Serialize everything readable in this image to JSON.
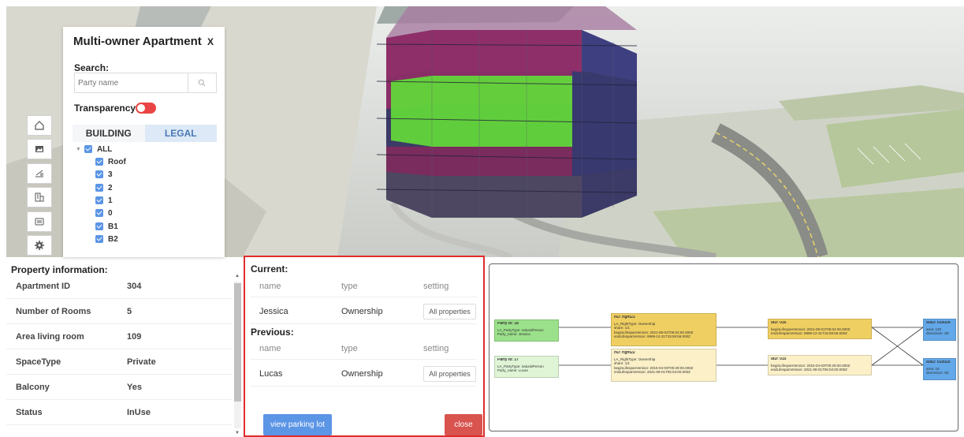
{
  "multi_owner": {
    "title": "Multi-owner Apartment",
    "close_label": "X",
    "search_label": "Search:",
    "search_placeholder": "Party name",
    "transparency_label": "Transparency:",
    "tabs": [
      "BUILDING",
      "LEGAL"
    ],
    "tree_root": "ALL",
    "tree_items": [
      "Roof",
      "3",
      "2",
      "1",
      "0",
      "B1",
      "B2"
    ]
  },
  "toolbar_icons": [
    "home-icon",
    "image-icon",
    "measure-icon",
    "building-icon",
    "layers-icon",
    "gear-icon"
  ],
  "property": {
    "title": "Property information:",
    "rows": [
      {
        "key": "Apartment ID",
        "value": "304"
      },
      {
        "key": "Number of Rooms",
        "value": "5"
      },
      {
        "key": "Area living room",
        "value": "109"
      },
      {
        "key": "SpaceType",
        "value": "Private"
      },
      {
        "key": "Balcony",
        "value": "Yes"
      },
      {
        "key": "Status",
        "value": "InUse"
      }
    ]
  },
  "ownership": {
    "current_label": "Current:",
    "previous_label": "Previous:",
    "columns": [
      "name",
      "type",
      "setting"
    ],
    "current": [
      {
        "name": "Jessica",
        "type": "Ownership",
        "setting": "All properties"
      }
    ],
    "previous": [
      {
        "name": "Lucas",
        "type": "Ownership",
        "setting": "All properties"
      }
    ],
    "view_parking_label": "view parking lot",
    "close_label": "close"
  },
  "diagram": {
    "parties": [
      {
        "title": "Party id: 18",
        "lines": [
          "LA_PartyType: naturalPerson",
          "Party_name: Jessica"
        ]
      },
      {
        "title": "Party id: 17",
        "lines": [
          "LA_PartyType: naturalPerson",
          "Party_name: Lucas"
        ]
      }
    ],
    "rights": [
      {
        "title": "rID: right23",
        "lines": [
          "LA_RightType: Ownership",
          "share: 1/1",
          "beginLifespanVersion: 2021-08-01T06:04:00.000Z",
          "endLifespanVersion: 9999-12-31T15:59:59.000Z"
        ]
      },
      {
        "title": "rID: right22",
        "lines": [
          "LA_RightType: Ownership",
          "share: 1/1",
          "beginLifespanVersion: 2015-04-03T00:29:00.000Z",
          "endLifespanVersion: 2021-08-01T06:04:00.000Z"
        ]
      }
    ],
    "uids": [
      {
        "title": "uID: 016",
        "lines": [
          "beginLifespanVersion: 2021-08-01T06:04:00.000Z",
          "endLifespanVersion: 9999-12-31T15:59:59.000Z"
        ]
      },
      {
        "title": "uID: 015",
        "lines": [
          "beginLifespanVersion: 2015-04-03T00:29:00.000Z",
          "endLifespanVersion: 2021-08-01T06:04:00.000Z"
        ]
      }
    ],
    "suids": [
      {
        "title": "suID: 010024",
        "lines": [
          "area: 120",
          "dimension: 3D"
        ]
      },
      {
        "title": "suID: 010025",
        "lines": [
          "area: 16",
          "dimension: 3D"
        ]
      }
    ]
  }
}
